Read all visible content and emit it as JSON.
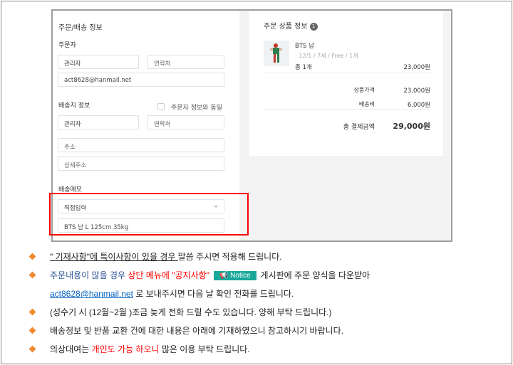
{
  "order_form": {
    "title": "주문/배송 정보",
    "orderer_label": "주문자",
    "orderer_name": "관리자",
    "orderer_phone_placeholder": "연락처",
    "orderer_email": "act8628@hanmail.net",
    "shipping_label": "배송지 정보",
    "same_as_orderer": "주문자 정보와 동일",
    "shipping_name": "관리자",
    "shipping_phone_placeholder": "연락처",
    "address_placeholder": "주소",
    "address_detail_placeholder": "상세주소",
    "memo_label": "배송메모",
    "memo_select": "직접입력",
    "memo_text": "BTS 남 L 125cm 35kg"
  },
  "order_summary": {
    "title": "주문 상품 정보",
    "count_badge": "1",
    "product_name": "BTS 남",
    "product_option": "- 12/1 / 7세 / Free / 1개",
    "product_qty": "총 1개",
    "product_price": "23,000원",
    "price_label": "상품가격",
    "price_value": "23,000원",
    "shipping_label": "배송비",
    "shipping_value": "6,000원",
    "total_label": "총 결제금액",
    "total_value": "29,000원"
  },
  "notes": {
    "l1a": "\" 기재사항\"에 특이사항이 있을 경우 ",
    "l1b": "말씀 주시면 적용해 드립니다.",
    "l2a": "주문내용이 많을 경우 ",
    "l2b": "상단 메뉴에 \"공지사항\"",
    "notice_btn": "Notice",
    "l2c": "게시판에 주문 양식을 다운받아",
    "l3_email": "act8628@hanmail.net",
    "l3b": " 로 보내주시면 다음 날 확인 전화를 드립니다.",
    "l4": "(성수기 시 (12월~2월 )조금 늦게 전화 드릴 수도 있습니다. 양해 부탁 드립니다.)",
    "l5": "배송정보 및 반품 교환 건에 대한 내용은 아래에 기재하였으니 참고하시기 바랍니다.",
    "l6a": "의상대여는 ",
    "l6b": "개인도 가능 하오니",
    "l6c": " 많은 이용 부탁 드립니다."
  },
  "colors": {
    "accent_orange": "#f08a30",
    "notice_teal": "#1aa89b",
    "highlight_red": "#ff0000"
  }
}
